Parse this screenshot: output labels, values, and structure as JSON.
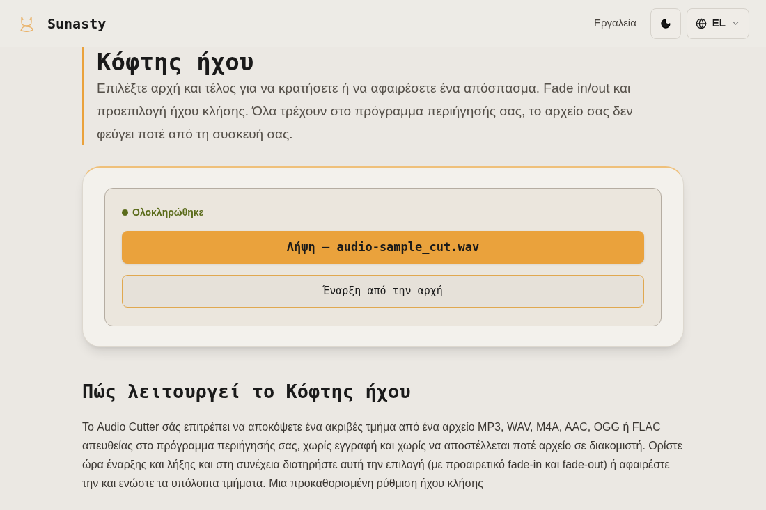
{
  "header": {
    "brand": "Sunasty",
    "nav_link": "Εργαλεία",
    "language": "EL"
  },
  "hero": {
    "title": "Κόφτης ήχου",
    "description": "Επιλέξτε αρχή και τέλος για να κρατήσετε ή να αφαιρέσετε ένα απόσπασμα. Fade in/out και προεπιλογή ήχου κλήσης. Όλα τρέχουν στο πρόγραμμα περιήγησής σας, το αρχείο σας δεν φεύγει ποτέ από τη συσκευή σας."
  },
  "result": {
    "status": {
      "label": "Ολοκληρώθηκε",
      "color": "#5a6b1a"
    },
    "buttons": [
      {
        "kind": "primary",
        "label": "Λήψη — audio-sample_cut.wav"
      },
      {
        "kind": "secondary",
        "label": "Έναρξη από την αρχή"
      }
    ]
  },
  "how_it_works": {
    "heading": "Πώς λειτουργεί το Κόφτης ήχου",
    "body": "Το Audio Cutter σάς επιτρέπει να αποκόψετε ένα ακριβές τμήμα από ένα αρχείο MP3, WAV, M4A, AAC, OGG ή FLAC απευθείας στο πρόγραμμα περιήγησής σας, χωρίς εγγραφή και χωρίς να αποστέλλεται ποτέ αρχείο σε διακομιστή. Ορίστε ώρα έναρξης και λήξης και στη συνέχεια διατηρήστε αυτή την επιλογή (με προαιρετικό fade-in και fade-out) ή αφαιρέστε την και ενώστε τα υπόλοιπα τμήματα. Μια προκαθορισμένη ρύθμιση ήχου κλήσης"
  }
}
